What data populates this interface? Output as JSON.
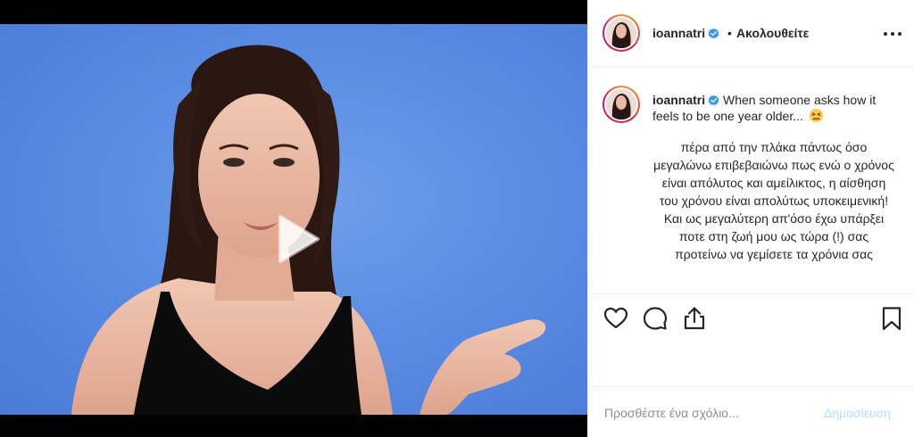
{
  "user": {
    "username": "ioannatri",
    "verified": true
  },
  "header": {
    "separator": "•",
    "follow_label": "Ακολουθείτε",
    "more_icon": "more-options-icon"
  },
  "caption": {
    "username": "ioannatri",
    "headline": "When someone asks how it feels to be one year older...",
    "emoji": "persevering-face-emoji",
    "body": "πέρα από την πλάκα πάντως όσο μεγαλώνω επιβεβαιώνω πως ενώ ο χρόνος είναι απόλυτος και αμείλικτος, η αίσθηση του χρόνου είναι απολύτως υποκειμενική! Και ως μεγαλύτερη απ'όσο έχω υπάρξει ποτε στη ζωή μου ως τώρα (!) σας προτείνω να γεμίσετε τα χρόνια σας"
  },
  "actions": {
    "like_icon": "heart-icon",
    "comment_icon": "comment-icon",
    "share_icon": "share-icon",
    "save_icon": "bookmark-icon"
  },
  "comment": {
    "placeholder": "Προσθέστε ένα σχόλιο...",
    "post_label": "Δημοσίευση"
  },
  "media": {
    "type": "video",
    "play_icon": "play-icon"
  },
  "colors": {
    "accent": "#0095f6",
    "post_disabled": "#b2dffc",
    "verified": "#3897f0",
    "video_background": "#5a8de4"
  }
}
